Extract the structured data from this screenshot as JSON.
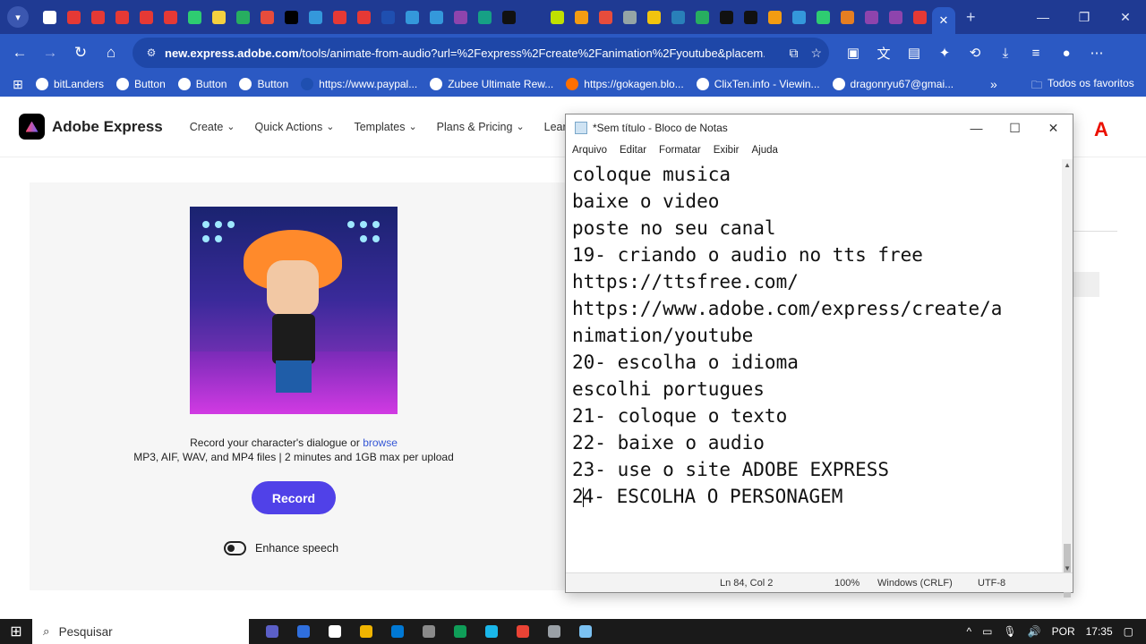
{
  "browser": {
    "tab_close": "✕",
    "new_tab": "+",
    "window": {
      "minimize": "—",
      "restore": "❐",
      "close": "✕"
    },
    "favicons": [
      "#ffffff",
      "#e53935",
      "#e53935",
      "#e53935",
      "#e53935",
      "#e53935",
      "#2ecc71",
      "#f4d03f",
      "#27ae60",
      "#e74c3c",
      "#000000",
      "#3498db",
      "#e53935",
      "#e53935",
      "#1f4fb0",
      "#3498db",
      "#3498db",
      "#8e44ad",
      "#16a085",
      "#111111",
      "#1f3a93",
      "#c0e000",
      "#f39c12",
      "#e74c3c",
      "#95a5a6",
      "#f1c40f",
      "#2980b9",
      "#27ae60",
      "#111111",
      "#111111",
      "#f39c12",
      "#3498db",
      "#2ecc71",
      "#e67e22",
      "#8e44ad",
      "#8e44ad",
      "#e53935"
    ],
    "url_host": "new.express.adobe.com",
    "url_path": "/tools/animate-from-audio?url=%2Fexpress%2Fcreate%2Fanimation%2Fyoutube&placem...",
    "bookmarks": [
      {
        "label": "bitLanders",
        "color": "#ffffff"
      },
      {
        "label": "Button",
        "color": "#ffffff"
      },
      {
        "label": "Button",
        "color": "#ffffff"
      },
      {
        "label": "Button",
        "color": "#ffffff"
      },
      {
        "label": "https://www.paypal...",
        "color": "#1f4fb0"
      },
      {
        "label": "Zubee Ultimate Rew...",
        "color": "#ffffff"
      },
      {
        "label": "https://gokagen.blo...",
        "color": "#ff6f00"
      },
      {
        "label": "ClixTen.info - Viewin...",
        "color": "#ffffff"
      },
      {
        "label": "dragonryu67@gmai...",
        "color": "#ffffff"
      }
    ],
    "more_bookmarks": "»",
    "all_favorites": "Todos os favoritos"
  },
  "adobe": {
    "brand": "Adobe Express",
    "menu": [
      "Create",
      "Quick Actions",
      "Templates",
      "Plans & Pricing",
      "Learn &"
    ],
    "record_prompt": "Record your character's dialogue or",
    "browse": "browse",
    "file_info": "MP3, AIF, WAV, and MP4 files | 2 minutes and 1GB max per upload",
    "record_button": "Record",
    "enhance_label": "Enhance speech"
  },
  "notepad": {
    "title": "*Sem título - Bloco de Notas",
    "menu": [
      "Arquivo",
      "Editar",
      "Formatar",
      "Exibir",
      "Ajuda"
    ],
    "lines": [
      "coloque musica",
      "baixe o video",
      "poste no seu canal",
      "19- criando o audio no tts free",
      "https://ttsfree.com/",
      "https://www.adobe.com/express/create/a",
      "nimation/youtube",
      "20- escolha o idioma",
      "escolhi portugues",
      "21- coloque o texto",
      "22- baixe o audio",
      "23- use o site ADOBE EXPRESS"
    ],
    "last_line_pre_caret": "2",
    "last_line_post_caret": "4- ESCOLHA O PERSONAGEM",
    "status": {
      "position": "Ln 84, Col 2",
      "zoom": "100%",
      "line_ending": "Windows (CRLF)",
      "encoding": "UTF-8"
    }
  },
  "taskbar": {
    "search_placeholder": "Pesquisar",
    "app_colors": [
      "#5b5fc7",
      "#2f6fde",
      "#ffffff",
      "#f0b400",
      "#0078d4",
      "#8a8a8a",
      "#0f9d58",
      "#1ab7ea",
      "#ea4335",
      "#9aa0a6",
      "#7bc1f2"
    ],
    "language": "POR",
    "time": "17:35"
  }
}
